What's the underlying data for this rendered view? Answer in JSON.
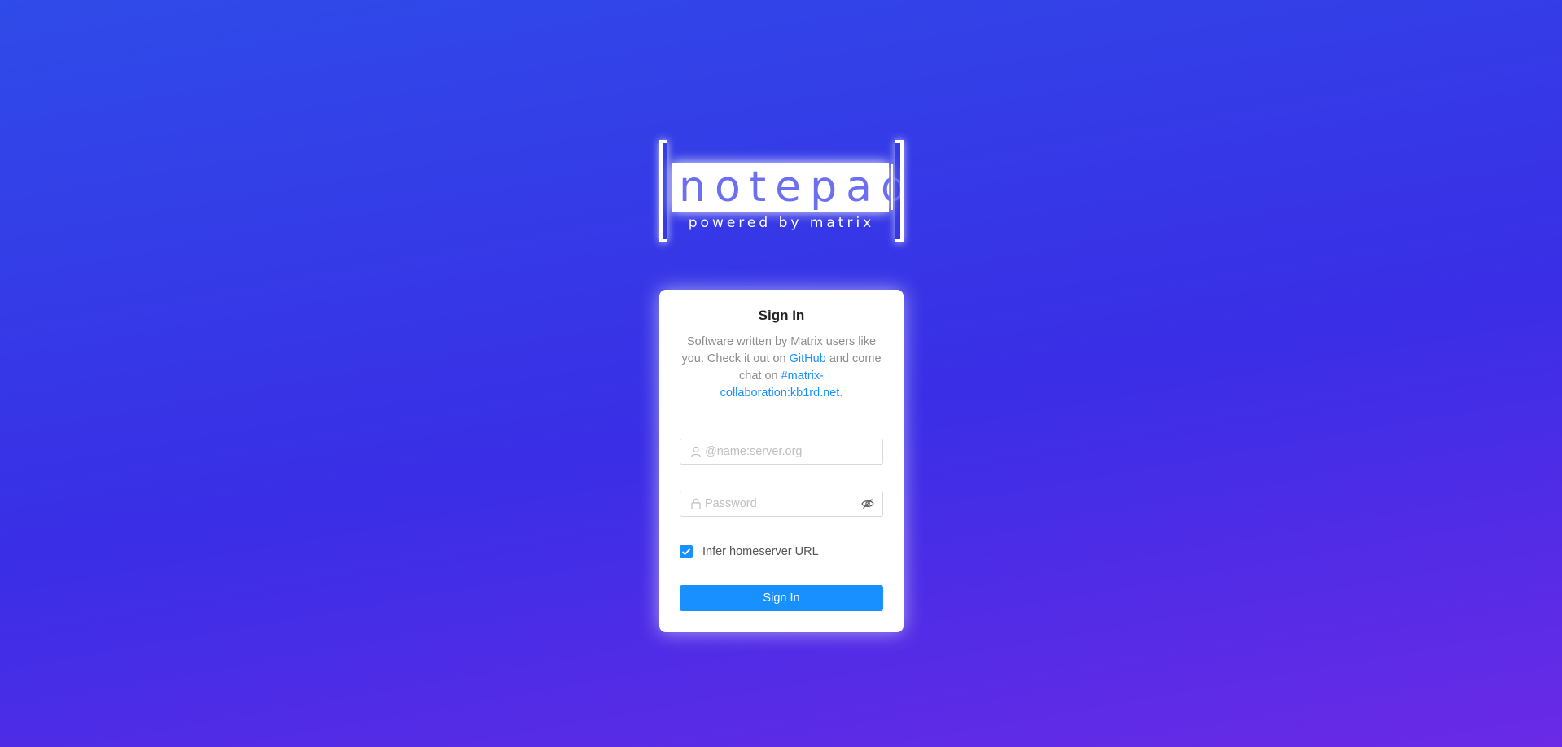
{
  "logo": {
    "word": "notepad",
    "tagline": "powered by matrix"
  },
  "card": {
    "title": "Sign In",
    "description": {
      "text_before": "Software written by Matrix users like you. Check it out on ",
      "github_link": "GitHub",
      "text_middle": " and come chat on ",
      "room_link": "#matrix-collaboration:kb1rd.net",
      "text_after": "."
    },
    "username": {
      "placeholder": "@name:server.org",
      "value": "",
      "icon": "user-icon"
    },
    "password": {
      "placeholder": "Password",
      "value": "",
      "icon": "lock-icon",
      "toggle_icon": "eye-hidden-icon"
    },
    "infer_homeserver": {
      "label": "Infer homeserver URL",
      "checked": true
    },
    "submit_label": "Sign In"
  },
  "colors": {
    "accent": "#1890ff",
    "background_top": "#2f4be8",
    "background_bottom": "#6a2ae6"
  }
}
